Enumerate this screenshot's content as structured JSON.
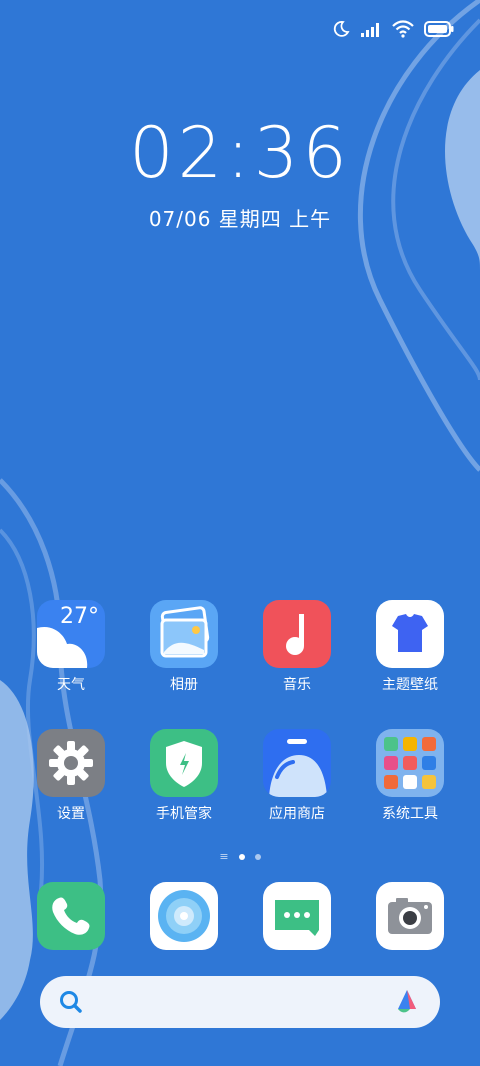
{
  "status_bar": {
    "icons": [
      "moon-icon",
      "signal-icon",
      "wifi-icon",
      "battery-icon"
    ]
  },
  "lock": {
    "time": "02:36",
    "date": "07/06 星期四 上午"
  },
  "apps_row1": [
    {
      "label": "天气",
      "icon": "weather-icon",
      "temp": "27°"
    },
    {
      "label": "相册",
      "icon": "gallery-icon"
    },
    {
      "label": "音乐",
      "icon": "music-icon"
    },
    {
      "label": "主题壁纸",
      "icon": "theme-icon"
    }
  ],
  "apps_row2": [
    {
      "label": "设置",
      "icon": "settings-icon"
    },
    {
      "label": "手机管家",
      "icon": "security-icon"
    },
    {
      "label": "应用商店",
      "icon": "app-store-icon"
    },
    {
      "label": "系统工具",
      "icon": "tools-folder-icon"
    }
  ],
  "page_indicator": {
    "pages": 2,
    "active": 1
  },
  "dock": [
    "phone-icon",
    "browser-icon",
    "messages-icon",
    "camera-icon"
  ],
  "search": {
    "left_icon": "search-icon",
    "right_icon": "assistant-icon"
  },
  "colors": {
    "background": "#2f77d6",
    "weather_blue": "#3a82f0",
    "music_red": "#f0525a",
    "green": "#3dbf85"
  }
}
